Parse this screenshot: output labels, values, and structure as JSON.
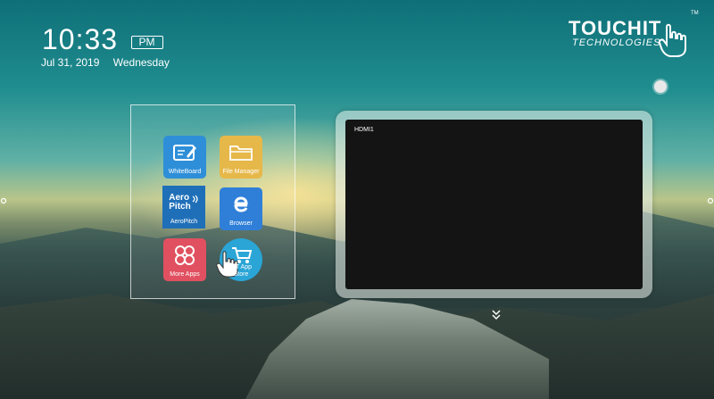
{
  "clock": {
    "time": "10:33",
    "ampm": "PM",
    "date": "Jul 31, 2019",
    "weekday": "Wednesday"
  },
  "logo": {
    "main": "TOUCHIT",
    "sub": "TECHNOLOGIES",
    "tm": "TM"
  },
  "apps": [
    {
      "label": "WhiteBoard",
      "icon": "whiteboard-icon",
      "color": "#2e8fd8"
    },
    {
      "label": "File Manager",
      "icon": "folder-icon",
      "color": "#e6b84a"
    },
    {
      "label": "AeroPitch",
      "icon": "aeropitch-icon",
      "icon_text_1": "Aero",
      "icon_text_2": "Pitch",
      "color": "#1f6fb8"
    },
    {
      "label": "Browser",
      "icon": "browser-icon",
      "color": "#2f7fd8"
    },
    {
      "label": "More Apps",
      "icon": "more-apps-icon",
      "color": "#e05060"
    },
    {
      "label": "TouchIT App Store",
      "label_line1": "hIT App",
      "label_line2": "Store",
      "icon": "app-store-icon",
      "color": "#2aa5d6"
    }
  ],
  "preview": {
    "source_label": "HDMI1"
  }
}
